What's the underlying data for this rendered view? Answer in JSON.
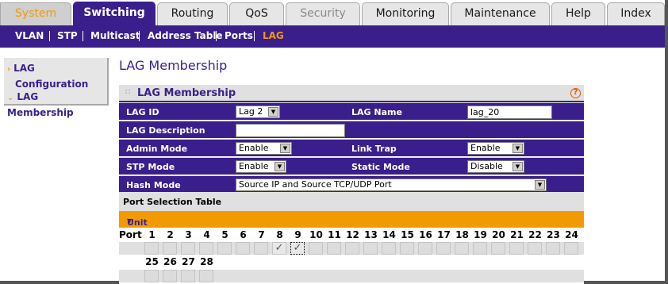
{
  "top_tabs": [
    {
      "label": "System",
      "state": "first"
    },
    {
      "label": "Switching",
      "state": "active"
    },
    {
      "label": "Routing",
      "state": "normal"
    },
    {
      "label": "QoS",
      "state": "normal"
    },
    {
      "label": "Security",
      "state": "disabled"
    },
    {
      "label": "Monitoring",
      "state": "normal"
    },
    {
      "label": "Maintenance",
      "state": "normal"
    },
    {
      "label": "Help",
      "state": "normal"
    },
    {
      "label": "Index",
      "state": "normal"
    }
  ],
  "subnav": {
    "items": [
      "VLAN",
      "STP",
      "Multicast",
      "Address Table",
      "Ports",
      "LAG"
    ],
    "active": "LAG"
  },
  "sidebar": {
    "items": [
      {
        "label_line1": "LAG",
        "label_line2": "Configuration"
      },
      {
        "label_line1": "LAG Membership"
      }
    ]
  },
  "page": {
    "title": "LAG Membership"
  },
  "panel": {
    "title": "LAG Membership",
    "help": "?",
    "fields": {
      "lag_id_label": "LAG ID",
      "lag_id_value": "Lag 2",
      "lag_name_label": "LAG Name",
      "lag_name_value": "lag_20",
      "lag_desc_label": "LAG Description",
      "lag_desc_value": "",
      "admin_mode_label": "Admin Mode",
      "admin_mode_value": "Enable",
      "link_trap_label": "Link Trap",
      "link_trap_value": "Enable",
      "stp_mode_label": "STP Mode",
      "stp_mode_value": "Enable",
      "static_mode_label": "Static Mode",
      "static_mode_value": "Disable",
      "hash_mode_label": "Hash Mode",
      "hash_mode_value": "Source IP and Source TCP/UDP Port"
    },
    "port_table": {
      "title": "Port Selection Table",
      "unit_label": "Unit 1",
      "port_label": "Port",
      "ports_row1": [
        "1",
        "2",
        "3",
        "4",
        "5",
        "6",
        "7",
        "8",
        "9",
        "10",
        "11",
        "12",
        "13",
        "14",
        "15",
        "16",
        "17",
        "18",
        "19",
        "20",
        "21",
        "22",
        "23",
        "24"
      ],
      "ports_row2": [
        "25",
        "26",
        "27",
        "28"
      ],
      "checked_ports": [
        "8",
        "9"
      ],
      "check_glyph": "✓"
    }
  },
  "colors": {
    "brand_purple": "#3a1f8c",
    "accent_orange": "#f29b00",
    "panel_grey": "#e0e0e0"
  }
}
